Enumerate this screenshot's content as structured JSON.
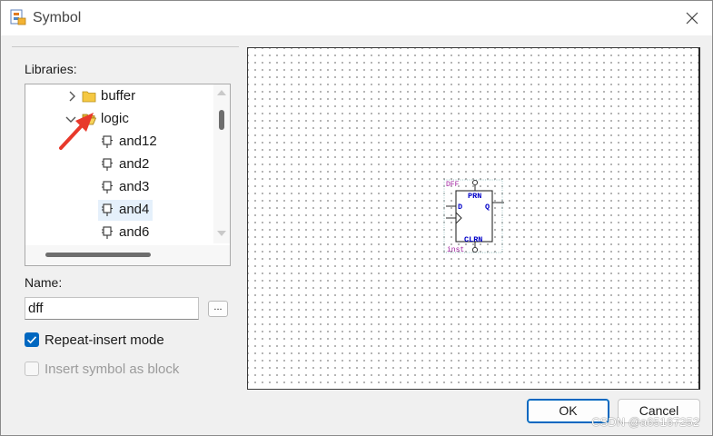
{
  "window": {
    "title": "Symbol",
    "close_glyph": "✕"
  },
  "libraries": {
    "label": "Libraries:",
    "tree": [
      {
        "kind": "folder",
        "expanded": false,
        "label": "buffer",
        "icon": "folder-icon"
      },
      {
        "kind": "folder",
        "expanded": true,
        "label": "logic",
        "icon": "folder-open-icon"
      },
      {
        "kind": "symbol",
        "label": "and12",
        "icon": "symbol-icon"
      },
      {
        "kind": "symbol",
        "label": "and2",
        "icon": "symbol-icon"
      },
      {
        "kind": "symbol",
        "label": "and3",
        "icon": "symbol-icon"
      },
      {
        "kind": "symbol",
        "label": "and4",
        "icon": "symbol-icon",
        "selected": true
      },
      {
        "kind": "symbol",
        "label": "and6",
        "icon": "symbol-icon"
      }
    ]
  },
  "name": {
    "label": "Name:",
    "value": "dff",
    "browse_label": "..."
  },
  "options": {
    "repeat_insert": {
      "label": "Repeat-insert mode",
      "checked": true
    },
    "insert_as_block": {
      "label": "Insert symbol as block",
      "checked": false,
      "disabled": true
    }
  },
  "preview": {
    "symbol": {
      "name": "DFF",
      "instance": "inst",
      "pins": {
        "d": "D",
        "q": "Q",
        "prn": "PRN",
        "clrn": "CLRN"
      }
    }
  },
  "buttons": {
    "ok": "OK",
    "cancel": "Cancel"
  },
  "watermark": "CSDN @a65167252",
  "colors": {
    "accent": "#0067c0",
    "symbol_blue": "#0000c8",
    "symbol_purple": "#a020a0",
    "annotation_red": "#e8392b"
  }
}
